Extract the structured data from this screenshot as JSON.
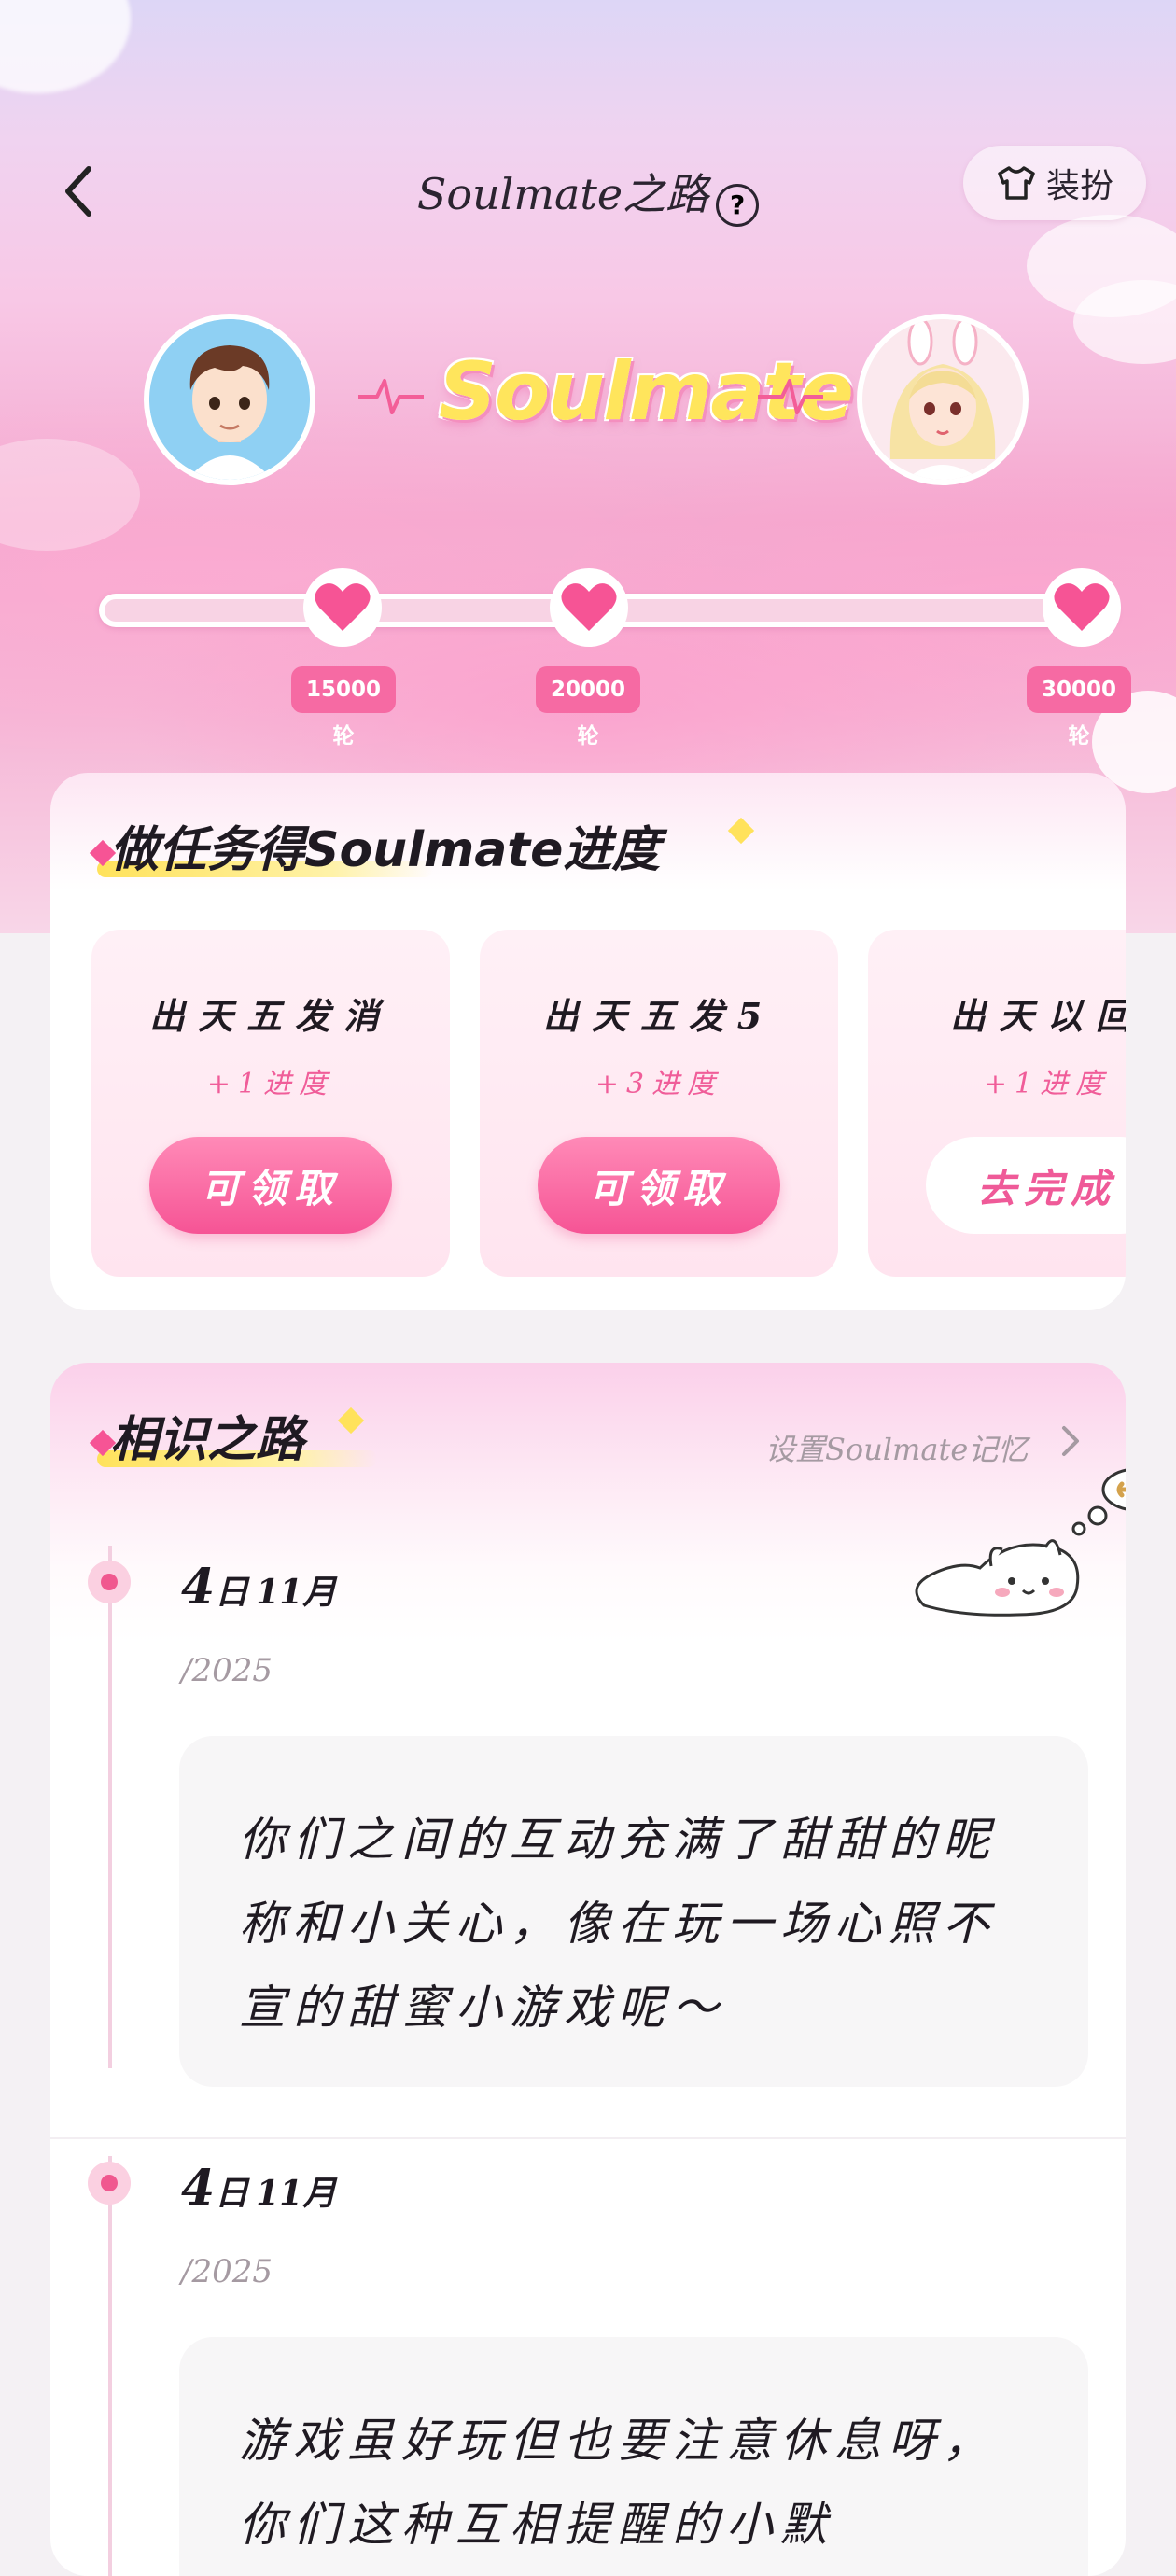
{
  "header": {
    "title": "Soulmate之路",
    "dress_up_label": "装扮"
  },
  "couple": {
    "brand": "Soulmate"
  },
  "progress": {
    "milestones": [
      "15000轮",
      "20000轮",
      "30000轮"
    ]
  },
  "tasks_section": {
    "title": "做任务得Soulmate进度",
    "tasks": [
      {
        "name": "出天五发消",
        "reward": "+1进度",
        "button": "可领取",
        "state": "claimable"
      },
      {
        "name": "出天五发5",
        "reward": "+3进度",
        "button": "可领取",
        "state": "claimable"
      },
      {
        "name": "出天以回",
        "reward": "+1进度",
        "button": "去完成",
        "state": "todo"
      }
    ]
  },
  "road_section": {
    "title": "相识之路",
    "memory_link": "设置Soulmate记忆",
    "entries": [
      {
        "day": "4",
        "day_suffix": "日",
        "month": "11月",
        "year": "/2025",
        "text": "你们之间的互动充满了甜甜的昵称和小关心，像在玩一场心照不宣的甜蜜小游戏呢～"
      },
      {
        "day": "4",
        "day_suffix": "日",
        "month": "11月",
        "year": "/2025",
        "text": "游戏虽好玩但也要注意休息呀，你们这种互相提醒的小默"
      }
    ]
  },
  "colors": {
    "accent": "#f65495",
    "title_yellow": "#ffe55c"
  }
}
